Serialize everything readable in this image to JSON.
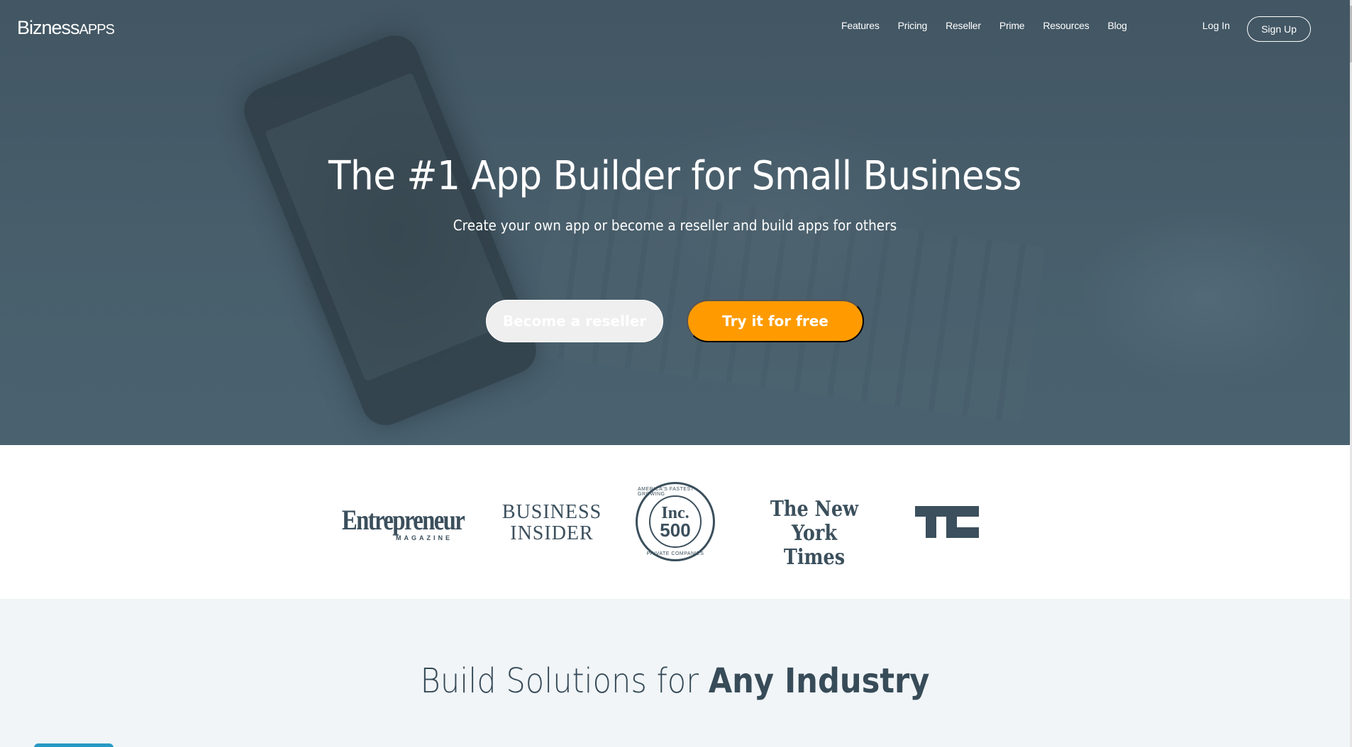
{
  "nav": {
    "logo_main": "Bizness",
    "logo_suffix": "APPS",
    "links": [
      "Features",
      "Pricing",
      "Reseller",
      "Prime",
      "Resources",
      "Blog"
    ],
    "login": "Log In",
    "signup": "Sign Up"
  },
  "hero": {
    "title": "The #1 App Builder for Small Business",
    "subtitle": "Create your own app or become a reseller and build apps for others",
    "secondary_button": "Become a reseller",
    "primary_button": "Try it for free",
    "primary_color": "#ff9b00"
  },
  "press": {
    "entrepreneur": {
      "main": "Entrepreneur",
      "sub": "MAGAZINE"
    },
    "business_insider": {
      "line1": "BUSINESS",
      "line2": "INSIDER"
    },
    "inc": {
      "top": "AMERICA'S FASTEST-GROWING",
      "line1": "Inc.",
      "line2": "500",
      "bottom": "PRIVATE COMPANIES"
    },
    "nyt": {
      "line1": "The New York",
      "line2": "Times"
    },
    "techcrunch": "TC"
  },
  "industry": {
    "title_light": "Build Solutions for ",
    "title_bold": "Any Industry"
  }
}
